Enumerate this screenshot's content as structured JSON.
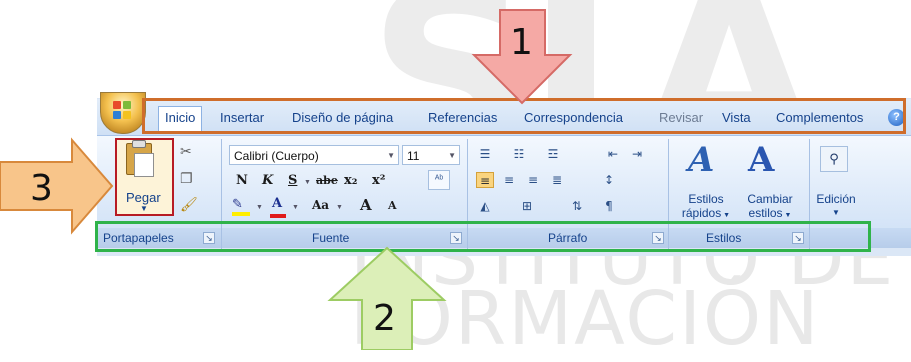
{
  "tabs": [
    "Inicio",
    "Insertar",
    "Diseño de página",
    "Referencias",
    "Correspondencia",
    "Revisar",
    "Vista",
    "Complementos"
  ],
  "clipboard": {
    "paste_label": "Pegar"
  },
  "font": {
    "name": "Calibri (Cuerpo)",
    "size": "11",
    "bold": "N",
    "italic": "K",
    "underline": "S",
    "strike": "abe",
    "subscript": "x₂",
    "superscript": "x²",
    "font_color": "A",
    "case": "Aa",
    "grow": "A",
    "shrink": "A"
  },
  "styles": {
    "quick_styles_l1": "Estilos",
    "quick_styles_l2": "rápidos",
    "change_styles_l1": "Cambiar",
    "change_styles_l2": "estilos",
    "edit_label": "Edición"
  },
  "groups": {
    "clipboard": "Portapapeles",
    "font": "Fuente",
    "paragraph": "Párrafo",
    "styles": "Estilos"
  },
  "annotations": {
    "one": "1",
    "two": "2",
    "three": "3"
  },
  "watermark": {
    "line1": "INSTITUTO DE",
    "line2": "FORMACIÓN"
  },
  "colors": {
    "orange": "#cf6d2b",
    "green": "#2fb34a",
    "red": "#b71b24",
    "arrow_pink": "#f5a9a5",
    "arrow_orange": "#f8c58a",
    "arrow_green": "#dcefb8"
  }
}
